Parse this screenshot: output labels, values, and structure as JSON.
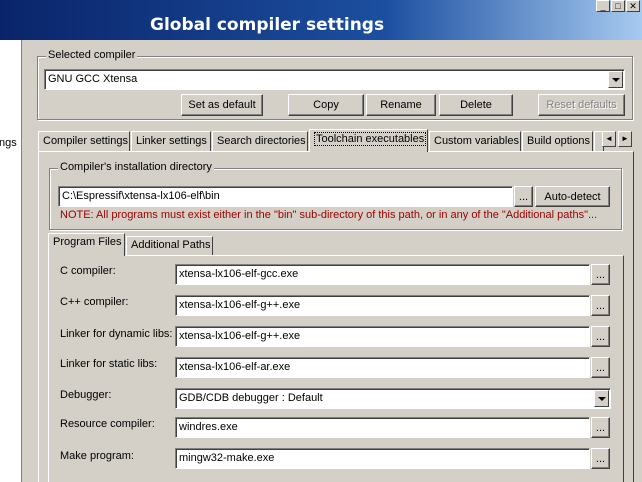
{
  "window": {
    "title": "Global compiler settings",
    "controls": {
      "minimize": "_",
      "maximize": "□",
      "close": "✕"
    }
  },
  "left_pane": {
    "partial_text": "ngs"
  },
  "selected_compiler": {
    "group_label": "Selected compiler",
    "value": "GNU GCC Xtensa",
    "buttons": {
      "set_default": "Set as default",
      "copy": "Copy",
      "rename": "Rename",
      "delete": "Delete",
      "reset_defaults": "Reset defaults"
    }
  },
  "tabs": [
    {
      "label": "Compiler settings"
    },
    {
      "label": "Linker settings"
    },
    {
      "label": "Search directories"
    },
    {
      "label": "Toolchain executables",
      "active": true
    },
    {
      "label": "Custom variables"
    },
    {
      "label": "Build options"
    }
  ],
  "tab_scroll": {
    "left": "◄",
    "right": "►"
  },
  "install_dir": {
    "group_label": "Compiler's installation directory",
    "value": "C:\\Espressif\\xtensa-lx106-elf\\bin",
    "browse": "...",
    "auto_detect": "Auto-detect",
    "note": "NOTE: All programs must exist either in the \"bin\" sub-directory of this path, or in any of the \"Additional paths\"..."
  },
  "subtabs": [
    {
      "label": "Program Files",
      "active": true
    },
    {
      "label": "Additional Paths"
    }
  ],
  "programs": [
    {
      "label": "C compiler:",
      "value": "xtensa-lx106-elf-gcc.exe",
      "kind": "text"
    },
    {
      "label": "C++ compiler:",
      "value": "xtensa-lx106-elf-g++.exe",
      "kind": "text"
    },
    {
      "label": "Linker for dynamic libs:",
      "value": "xtensa-lx106-elf-g++.exe",
      "kind": "text"
    },
    {
      "label": "Linker for static libs:",
      "value": "xtensa-lx106-elf-ar.exe",
      "kind": "text"
    },
    {
      "label": "Debugger:",
      "value": "GDB/CDB debugger : Default",
      "kind": "select"
    },
    {
      "label": "Resource compiler:",
      "value": "windres.exe",
      "kind": "text"
    },
    {
      "label": "Make program:",
      "value": "mingw32-make.exe",
      "kind": "text"
    }
  ],
  "browse_label": "..."
}
